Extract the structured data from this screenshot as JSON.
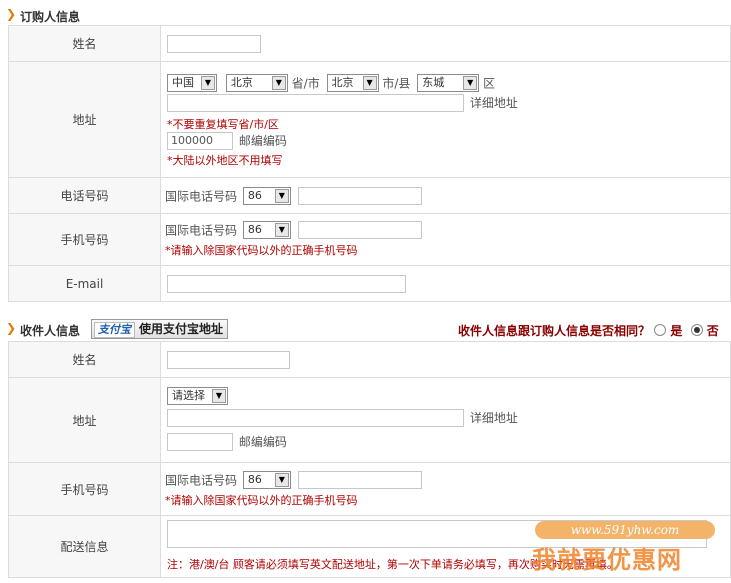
{
  "buyer": {
    "title": "订购人信息",
    "name_label": "姓名",
    "address_label": "地址",
    "country": "中国",
    "province": "北京",
    "province_suffix": "省/市",
    "city": "北京",
    "city_suffix": "市/县",
    "district": "东城",
    "district_suffix": "区",
    "detail_label": "详细地址",
    "address_warn": "*不要重复填写省/市/区",
    "postcode_value": "100000",
    "postcode_label": "邮编编码",
    "postcode_warn": "*大陆以外地区不用填写",
    "phone_label": "电话号码",
    "intl_label": "国际电话号码",
    "phone_code": "86",
    "mobile_label": "手机号码",
    "mobile_code": "86",
    "mobile_warn": "*请输入除国家代码以外的正确手机号码",
    "email_label": "E-mail"
  },
  "receiver": {
    "title": "收件人信息",
    "alipay_logo": "支付宝",
    "alipay_button": "使用支付宝地址",
    "same_question": "收件人信息跟订购人信息是否相同？",
    "yes_label": "是",
    "no_label": "否",
    "name_label": "姓名",
    "address_label": "地址",
    "region_select": "请选择",
    "detail_label": "详细地址",
    "postcode_label": "邮编编码",
    "mobile_label": "手机号码",
    "intl_label": "国际电话号码",
    "mobile_code": "86",
    "mobile_warn": "*请输入除国家代码以外的正确手机号码",
    "delivery_label": "配送信息",
    "delivery_note": "注：港/澳/台 顾客请必须填写英文配送地址，第一次下单请务必填写，再次购买时无需再填。"
  },
  "watermark": {
    "url": "www.591yhw.com",
    "text": "我就要优惠网"
  }
}
